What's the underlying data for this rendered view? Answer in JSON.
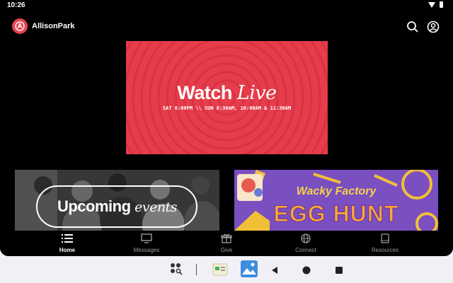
{
  "status_bar": {
    "time": "10:26",
    "icons": [
      "wifi-icon",
      "battery-icon"
    ]
  },
  "app_bar": {
    "app_name": "AllisonPark",
    "icons": [
      "search-icon",
      "account-icon"
    ]
  },
  "hero": {
    "title_main": "Watch",
    "title_accent": "Live",
    "schedule": "SAT 6:00PM  \\\\  SUN 8:30AM, 10:00AM & 11:30AM",
    "background": "#e63c4b"
  },
  "cards": {
    "events": {
      "title_main": "Upcoming",
      "title_accent": "events"
    },
    "egg_hunt": {
      "line1": "Wacky Factory",
      "line2": "EGG HUNT",
      "background": "#7a4fc0"
    }
  },
  "bottom_nav": {
    "items": [
      {
        "label": "Home",
        "icon": "list-icon",
        "active": true
      },
      {
        "label": "Messages",
        "icon": "monitor-icon",
        "active": false
      },
      {
        "label": "Give",
        "icon": "gift-icon",
        "active": false
      },
      {
        "label": "Connect",
        "icon": "globe-icon",
        "active": false
      },
      {
        "label": "Resources",
        "icon": "book-icon",
        "active": false
      }
    ]
  },
  "system_nav": {
    "icons": [
      "app-drawer-icon",
      "app-thumbnail-icon",
      "photos-app-icon",
      "back-icon",
      "home-icon",
      "recents-icon"
    ]
  },
  "colors": {
    "accent": "#e84354",
    "nav_active": "#ffffff",
    "nav_inactive": "#9a9a9a"
  }
}
